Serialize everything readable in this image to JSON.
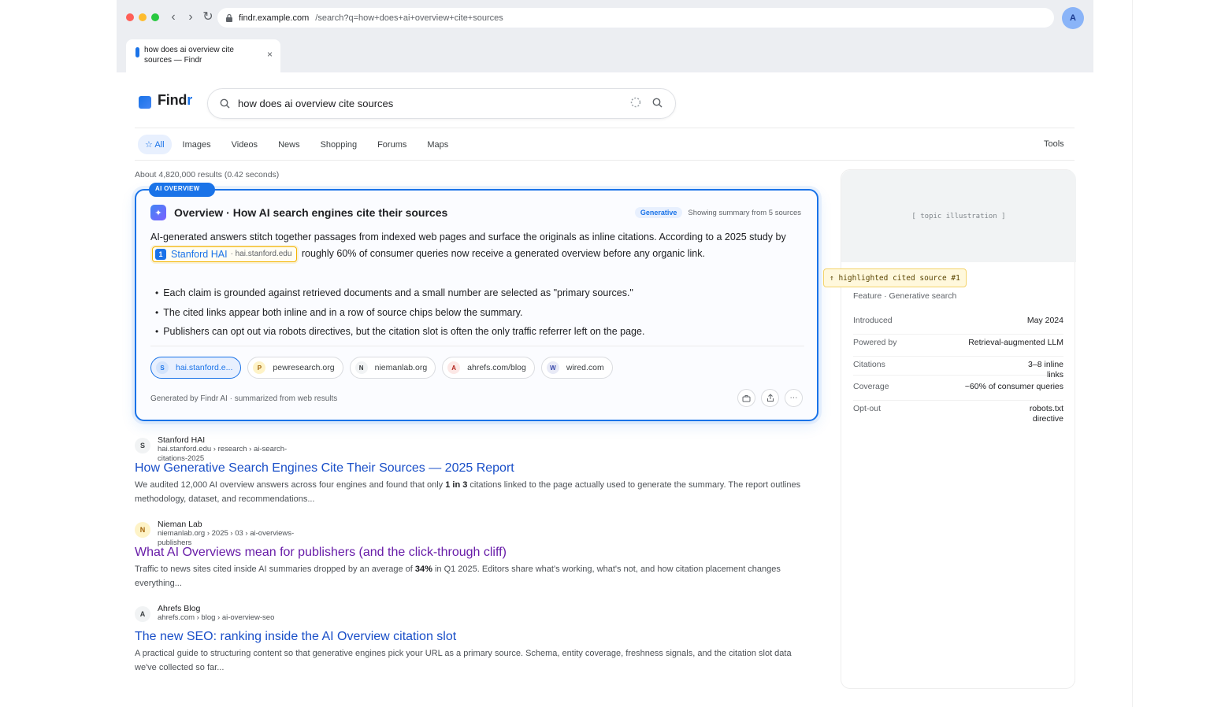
{
  "browser": {
    "url_host": "findr.example.com",
    "url_path": "/search?q=how+does+ai+overview+cite+sources",
    "profile_initial": "A",
    "tab_title": "how does ai overview cite sources — Findr",
    "tab_close": "×"
  },
  "header": {
    "logo_main": "Find",
    "logo_accent": "r",
    "query": "how does ai overview cite sources"
  },
  "nav": {
    "tabs": [
      "All",
      "Images",
      "Videos",
      "News",
      "Shopping",
      "Forums",
      "Maps"
    ],
    "tools": "Tools"
  },
  "stats": "About 4,820,000 results (0.42 seconds)",
  "ai_overview": {
    "pill": "AI OVERVIEW",
    "title": "Overview · How AI search engines cite their sources",
    "badge": "Generative",
    "meta": "Showing summary from 5 sources",
    "para_before": "AI-generated answers stitch together passages from indexed web pages and surface the originals as inline citations. According to a 2025 study by",
    "cite_num": "1",
    "cite_name": "Stanford HAI",
    "cite_domain": "· hai.stanford.edu",
    "para_after": "roughly 60% of consumer queries now receive a generated overview before any organic link.",
    "bullets": [
      "Each claim is grounded against retrieved documents and a small number are selected as \"primary sources.\"",
      "The cited links appear both inline and in a row of source chips below the summary.",
      "Publishers can opt out via robots directives, but the citation slot is often the only traffic referrer left on the page."
    ],
    "chips": [
      {
        "initial": "S",
        "label": "hai.stanford.e..."
      },
      {
        "initial": "P",
        "label": "pewresearch.org"
      },
      {
        "initial": "N",
        "label": "niemanlab.org"
      },
      {
        "initial": "A",
        "label": "ahrefs.com/blog"
      },
      {
        "initial": "W",
        "label": "wired.com"
      }
    ],
    "footer": "Generated by Findr AI · summarized from web results"
  },
  "results": [
    {
      "initial": "S",
      "site": "Stanford HAI",
      "url": "hai.stanford.edu › research › ai-search-citations-2025",
      "title": "How Generative Search Engines Cite Their Sources — 2025 Report",
      "snippet_a": "We audited 12,000 AI overview answers across four engines and found that only ",
      "snippet_b": "1 in 3",
      "snippet_c": " citations linked to the page actually used to generate the summary. The report outlines methodology, dataset, and recommendations..."
    },
    {
      "initial": "N",
      "site": "Nieman Lab",
      "url": "niemanlab.org › 2025 › 03 › ai-overviews-publishers",
      "title": "What AI Overviews mean for publishers (and the click-through cliff)",
      "snippet_a": "Traffic to news sites cited inside AI summaries dropped by an average of ",
      "snippet_b": "34%",
      "snippet_c": " in Q1 2025. Editors share what's working, what's not, and how citation placement changes everything..."
    },
    {
      "initial": "A",
      "site": "Ahrefs Blog",
      "url": "ahrefs.com › blog › ai-overview-seo",
      "title": "The new SEO: ranking inside the AI Overview citation slot",
      "snippet_a": "A practical guide to structuring content so that generative engines pick your URL as a primary source. Schema, entity coverage, freshness signals, and the citation slot data we've collected so far...",
      "snippet_b": "",
      "snippet_c": ""
    }
  ],
  "knowledge_panel": {
    "image_label": "[ topic illustration ]",
    "highlight_tag": "↑ highlighted cited source #1",
    "subtitle": "Feature · Generative search",
    "rows": [
      {
        "k": "Introduced",
        "v": "May 2024"
      },
      {
        "k": "Powered by",
        "v": "Retrieval-augmented LLM"
      },
      {
        "k": "Citations",
        "v": "3–8 inline links"
      },
      {
        "k": "Coverage",
        "v": "~60% of consumer queries"
      },
      {
        "k": "Opt-out",
        "v": "robots.txt directive"
      }
    ]
  },
  "colors": {
    "accent": "#1a73e8",
    "highlight": "#f4b400",
    "visited": "#681da8"
  }
}
